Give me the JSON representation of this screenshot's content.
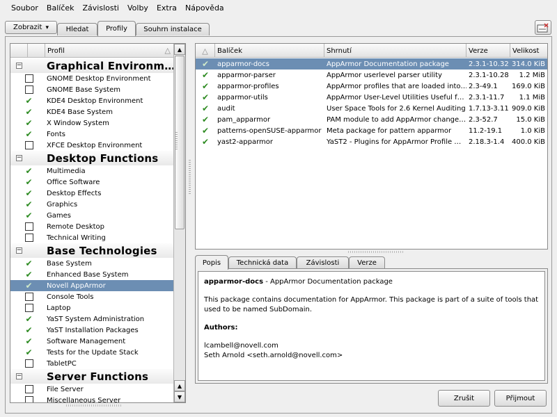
{
  "menu": [
    "Soubor",
    "Balíček",
    "Závislosti",
    "Volby",
    "Extra",
    "Nápověda"
  ],
  "toolbar": {
    "view_label": "Zobrazit",
    "view_arrow": "▾",
    "tabs": [
      "Hledat",
      "Profily",
      "Souhrn instalace"
    ],
    "active_tab": "Profily"
  },
  "profiles": {
    "column_header": "Profil",
    "sort_icon": "sort-ascending-icon",
    "rows": [
      {
        "kind": "cat",
        "label": "Graphical Environm…"
      },
      {
        "kind": "item",
        "state": "unchecked",
        "label": "GNOME Desktop Environment"
      },
      {
        "kind": "item",
        "state": "unchecked",
        "label": "GNOME Base System"
      },
      {
        "kind": "item",
        "state": "checked",
        "label": "KDE4 Desktop Environment"
      },
      {
        "kind": "item",
        "state": "checked",
        "label": "KDE4 Base System"
      },
      {
        "kind": "item",
        "state": "checked",
        "label": "X Window System"
      },
      {
        "kind": "item",
        "state": "checked",
        "label": "Fonts"
      },
      {
        "kind": "item",
        "state": "unchecked",
        "label": "XFCE Desktop Environment"
      },
      {
        "kind": "cat",
        "label": "Desktop Functions"
      },
      {
        "kind": "item",
        "state": "checked",
        "label": "Multimedia"
      },
      {
        "kind": "item",
        "state": "checked",
        "label": "Office Software"
      },
      {
        "kind": "item",
        "state": "checked",
        "label": "Desktop Effects"
      },
      {
        "kind": "item",
        "state": "checked",
        "label": "Graphics"
      },
      {
        "kind": "item",
        "state": "checked",
        "label": "Games"
      },
      {
        "kind": "item",
        "state": "unchecked",
        "label": "Remote Desktop"
      },
      {
        "kind": "item",
        "state": "unchecked",
        "label": "Technical Writing"
      },
      {
        "kind": "cat",
        "label": "Base Technologies"
      },
      {
        "kind": "item",
        "state": "checked",
        "label": "Base System"
      },
      {
        "kind": "item",
        "state": "checked",
        "label": "Enhanced Base System"
      },
      {
        "kind": "item",
        "state": "checked",
        "label": "Novell AppArmor",
        "selected": true
      },
      {
        "kind": "item",
        "state": "unchecked",
        "label": "Console Tools"
      },
      {
        "kind": "item",
        "state": "unchecked",
        "label": "Laptop"
      },
      {
        "kind": "item",
        "state": "checked",
        "label": "YaST System Administration"
      },
      {
        "kind": "item",
        "state": "checked",
        "label": "YaST Installation Packages"
      },
      {
        "kind": "item",
        "state": "checked",
        "label": "Software Management"
      },
      {
        "kind": "item",
        "state": "checked",
        "label": "Tests for the Update Stack"
      },
      {
        "kind": "item",
        "state": "unchecked",
        "label": "TabletPC"
      },
      {
        "kind": "cat",
        "label": "Server Functions"
      },
      {
        "kind": "item",
        "state": "unchecked",
        "label": "File Server"
      },
      {
        "kind": "item",
        "state": "unchecked",
        "label": "Miscellaneous Server"
      }
    ]
  },
  "packages": {
    "columns": [
      "Balíček",
      "Shrnutí",
      "Verze",
      "Velikost"
    ],
    "rows": [
      {
        "name": "apparmor-docs",
        "summary": "AppArmor Documentation package",
        "version": "2.3.1-10.32",
        "size": "314.0 KiB",
        "selected": true
      },
      {
        "name": "apparmor-parser",
        "summary": "AppArmor userlevel parser utility",
        "version": "2.3.1-10.28",
        "size": "1.2 MiB"
      },
      {
        "name": "apparmor-profiles",
        "summary": "AppArmor profiles that are loaded into…",
        "version": "2.3-49.1",
        "size": "169.0 KiB"
      },
      {
        "name": "apparmor-utils",
        "summary": "AppArmor User-Level Utilities Useful f…",
        "version": "2.3.1-11.7",
        "size": "1.1 MiB"
      },
      {
        "name": "audit",
        "summary": "User Space Tools for 2.6 Kernel Auditing",
        "version": "1.7.13-3.11",
        "size": "909.0 KiB"
      },
      {
        "name": "pam_apparmor",
        "summary": "PAM module to add AppArmor change…",
        "version": "2.3-52.7",
        "size": "15.0 KiB"
      },
      {
        "name": "patterns-openSUSE-apparmor",
        "summary": "Meta package for pattern apparmor",
        "version": "11.2-19.1",
        "size": "1.0 KiB"
      },
      {
        "name": "yast2-apparmor",
        "summary": "YaST2 - Plugins for AppArmor Profile …",
        "version": "2.18.3-1.4",
        "size": "400.0 KiB"
      }
    ]
  },
  "details": {
    "tabs": [
      "Popis",
      "Technická data",
      "Závislosti",
      "Verze"
    ],
    "active_tab": "Popis",
    "title_name": "apparmor-docs",
    "title_summary": " - AppArmor Documentation package",
    "description": "This package contains documentation for AppArmor. This package is part of a suite of tools that used to be named SubDomain.",
    "authors_label": "Authors:",
    "authors": [
      "lcambell@novell.com",
      "Seth Arnold <seth.arnold@novell.com>"
    ]
  },
  "buttons": {
    "cancel": "Zrušit",
    "accept": "Přijmout"
  },
  "colors": {
    "selection": "#6c8eb3",
    "check": "#2e8b22"
  }
}
